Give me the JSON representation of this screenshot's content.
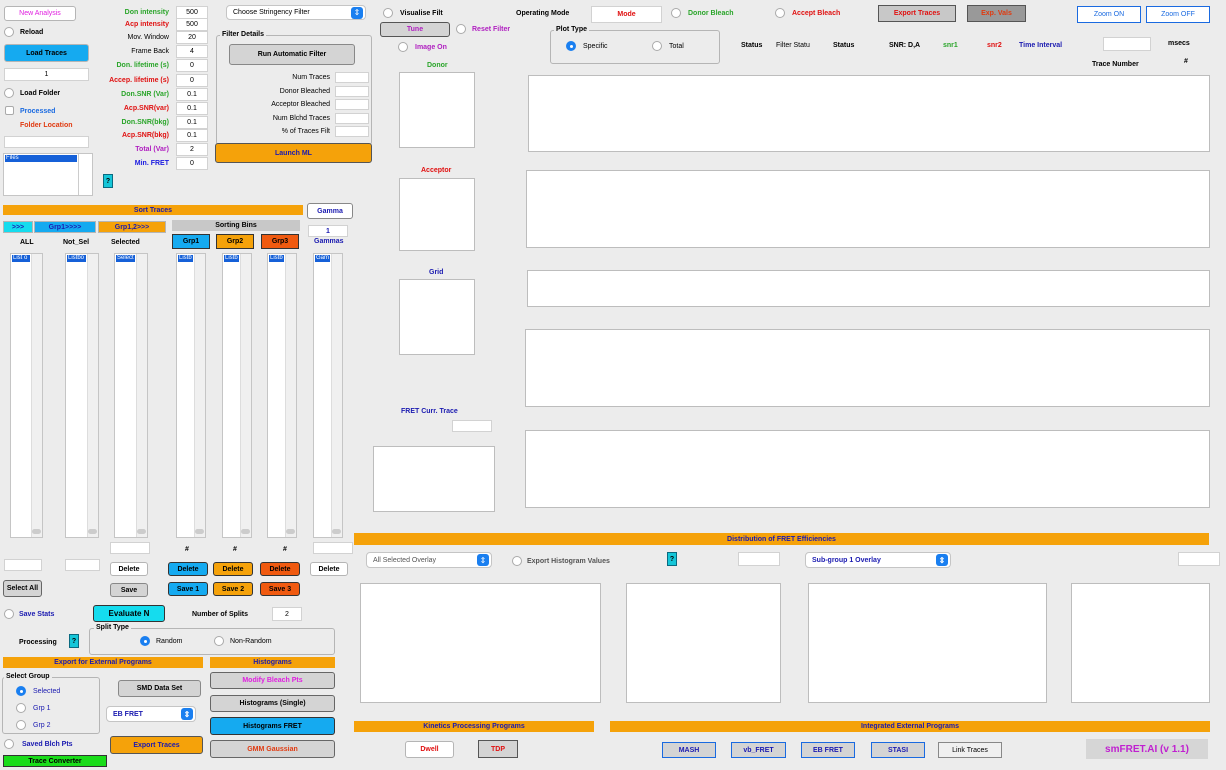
{
  "left": {
    "new_analysis": "New Analysis",
    "reload": "Reload",
    "load_traces": "Load Traces",
    "trace_index": "1",
    "load_folder": "Load Folder",
    "processed": "Processed",
    "folder_location": "Folder Location",
    "files_item": "Files",
    "help": "?"
  },
  "params": [
    {
      "label": "Don intensity",
      "value": "500",
      "color": "#2aa52a"
    },
    {
      "label": "Acp intensity",
      "value": "500",
      "color": "#e01010"
    },
    {
      "label": "Mov. Window",
      "value": "20",
      "color": "#000000"
    },
    {
      "label": "Frame Back",
      "value": "4",
      "color": "#000000"
    },
    {
      "label": "Don. lifetime (s)",
      "value": "0",
      "color": "#2aa52a"
    },
    {
      "label": "Accep. lifetime (s)",
      "value": "0",
      "color": "#e01010"
    },
    {
      "label": "Don.SNR (Var)",
      "value": "0.1",
      "color": "#2aa52a"
    },
    {
      "label": "Acp.SNR(var)",
      "value": "0.1",
      "color": "#e01010"
    },
    {
      "label": "Don.SNR(bkg)",
      "value": "0.1",
      "color": "#2aa52a"
    },
    {
      "label": "Acp.SNR(bkg)",
      "value": "0.1",
      "color": "#e01010"
    },
    {
      "label": "Total (Var)",
      "value": "2",
      "color": "#b020c0"
    },
    {
      "label": "Min. FRET",
      "value": "0",
      "color": "#1a1ae0"
    }
  ],
  "filter": {
    "stringency": "Choose Stringency Filter",
    "details_title": "Filter Details",
    "run": "Run Automatic Filter",
    "rows": [
      "Num Traces",
      "Donor Bleached",
      "Acceptor Bleached",
      "Num Blchd Traces",
      "% of Traces Filt"
    ],
    "launch": "Launch ML"
  },
  "sort": {
    "title": "Sort Traces",
    "gamma_btn": "Gamma",
    "btn1": ">>>",
    "btn2": "Grp1>>>>",
    "btn3": "Grp1,2>>>",
    "bins_title": "Sorting Bins",
    "gamma_value": "1",
    "col_all": "ALL",
    "col_notsel": "Not_Sel",
    "col_selected": "Selected",
    "grp1": "Grp1",
    "grp2": "Grp2",
    "grp3": "Grp3",
    "gammas": "Gammas",
    "list_items": [
      "List o",
      "Listbo",
      "Select",
      "Listb",
      "Listb",
      "Listb",
      "Gam"
    ],
    "hash": "#",
    "delete": "Delete",
    "save": "Save",
    "save1": "Save 1",
    "save2": "Save 2",
    "save3": "Save 3",
    "select_all": "Select All",
    "save_stats": "Save Stats",
    "evaluate": "Evaluate N",
    "num_splits_label": "Number of Splits",
    "num_splits": "2",
    "processing": "Processing",
    "split_type": "Split Type",
    "random": "Random",
    "nonrandom": "Non-Random"
  },
  "export": {
    "title": "Export for External Programs",
    "histograms": "Histograms",
    "select_group": "Select Group",
    "selected": "Selected",
    "grp1": "Grp 1",
    "grp2": "Grp 2",
    "smd": "SMD Data Set",
    "ebfret": "EB FRET",
    "export_traces": "Export Traces",
    "saved_blch": "Saved Blch Pts",
    "trace_converter": "Trace Converter",
    "modify": "Modify Bleach Pts",
    "hist_single": "Histograms (Single)",
    "hist_fret": "Histograms FRET",
    "gmm": "GMM Gaussian"
  },
  "top": {
    "visualise": "Visualise Filt",
    "operating_mode": "Operating Mode",
    "mode": "Mode",
    "donor_bleach": "Donor Bleach",
    "accept_bleach": "Accept Bleach",
    "export_traces": "Export Traces",
    "exp_vals": "Exp. Vals",
    "zoom_on": "Zoom ON",
    "zoom_off": "Zoom OFF",
    "tune": "Tune",
    "reset": "Reset Filter",
    "plot_type": "Plot Type",
    "specific": "Specific",
    "total": "Total",
    "image_on": "Image On",
    "status1": "Status",
    "filter_status": "Filter Statu",
    "status2": "Status",
    "snr": "SNR: D,A",
    "snr1": "snr1",
    "snr2": "snr2",
    "time_interval": "Time Interval",
    "msecs": "msecs",
    "trace_number": "Trace Number",
    "hash": "#"
  },
  "panels": {
    "donor": "Donor",
    "acceptor": "Acceptor",
    "grid": "Grid",
    "fret": "FRET Curr. Trace"
  },
  "dist": {
    "title": "Distribution of FRET Efficiencies",
    "overlay": "All Selected Overlay",
    "export_hist": "Export Histogram Values",
    "sub": "Sub-group 1 Overlay"
  },
  "bottom": {
    "kinetics": "Kinetics Processing Programs",
    "dwell": "Dwell",
    "tdp": "TDP",
    "integrated": "Integrated External Programs",
    "mash": "MASH",
    "vb": "vb_FRET",
    "eb": "EB FRET",
    "stasi": "STASI",
    "link": "Link Traces",
    "brand": "smFRET.AI  (v 1.1)"
  }
}
